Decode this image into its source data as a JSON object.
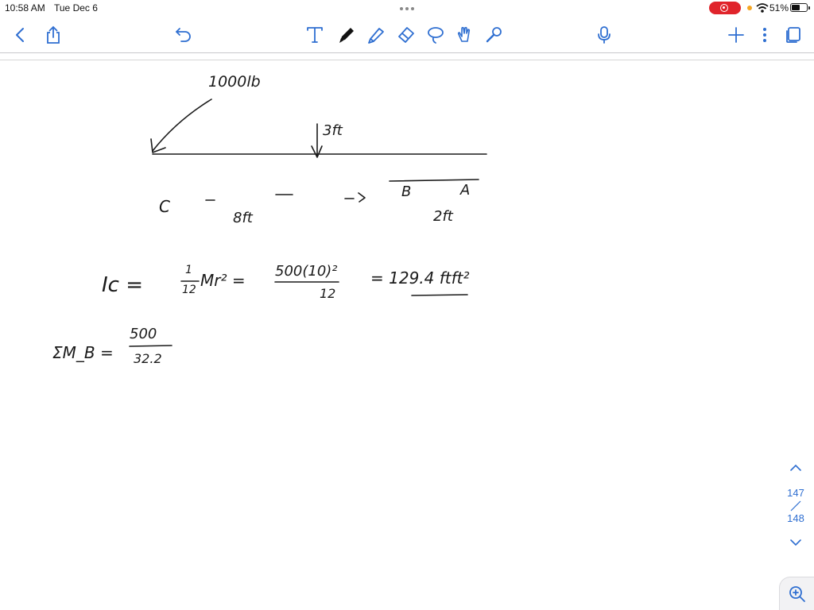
{
  "status_bar": {
    "time": "10:58 AM",
    "date": "Tue Dec 6",
    "battery": "51%"
  },
  "icons": {
    "back": "chevron-left-icon",
    "share": "share-icon",
    "undo": "undo-icon",
    "text": "text-tool-icon",
    "pen": "pen-icon",
    "highlighter": "highlighter-icon",
    "eraser": "eraser-icon",
    "lasso": "lasso-icon",
    "shapes": "shapes-icon",
    "laser": "laser-pointer-icon",
    "mic": "microphone-icon",
    "add": "plus-icon",
    "more": "more-icon",
    "pages": "pages-icon",
    "zoom": "zoom-in-icon"
  },
  "colors": {
    "accent": "#2f6fd1",
    "recording": "#e0242b",
    "ink": "#1a1a1a"
  },
  "notes": {
    "force": "1000lb",
    "dist_3": "3ft",
    "label_c": "C",
    "dist_8": "8ft",
    "label_b": "B",
    "label_a": "A",
    "dist_2": "2ft",
    "ic_lhs": "Ic =",
    "ic_frac_num": "1",
    "ic_frac_den": "12",
    "ic_mr2": "Mr² =",
    "ic_num": "500(10)²",
    "ic_den": "12",
    "ic_result": "= 129.4 ftft²",
    "sum_lhs": "ΣM_B =",
    "sum_num": "500",
    "sum_den": "32.2"
  },
  "pager": {
    "current": "147",
    "total": "148"
  }
}
